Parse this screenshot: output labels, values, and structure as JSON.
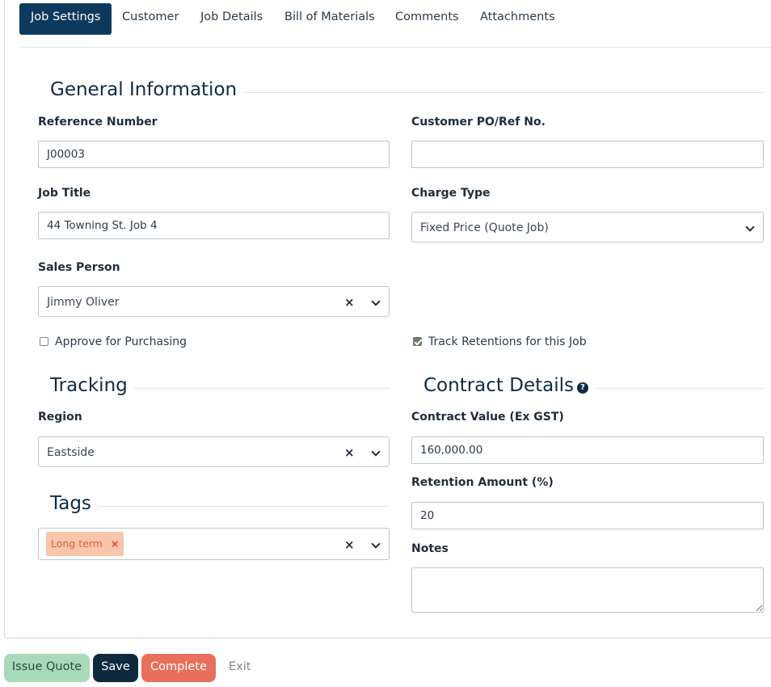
{
  "tabs": [
    {
      "label": "Job Settings",
      "active": true
    },
    {
      "label": "Customer"
    },
    {
      "label": "Job Details"
    },
    {
      "label": "Bill of Materials"
    },
    {
      "label": "Comments"
    },
    {
      "label": "Attachments"
    }
  ],
  "general": {
    "title": "General Information",
    "reference_label": "Reference Number",
    "reference_value": "J00003",
    "customer_po_label": "Customer PO/Ref No.",
    "customer_po_value": "",
    "job_title_label": "Job Title",
    "job_title_value": "44 Towning St. Job 4",
    "charge_type_label": "Charge Type",
    "charge_type_value": "Fixed Price (Quote Job)",
    "sales_person_label": "Sales Person",
    "sales_person_value": "Jimmy Oliver",
    "approve_label": "Approve for Purchasing",
    "approve_checked": false,
    "track_retentions_label": "Track Retentions for this Job",
    "track_retentions_checked": true
  },
  "tracking": {
    "title": "Tracking",
    "region_label": "Region",
    "region_value": "Eastside"
  },
  "tags": {
    "title": "Tags",
    "items": [
      "Long term"
    ]
  },
  "contract": {
    "title": "Contract Details",
    "contract_value_label": "Contract Value (Ex GST)",
    "contract_value": "160,000.00",
    "retention_label": "Retention Amount (%)",
    "retention_value": "20",
    "notes_label": "Notes",
    "notes_value": ""
  },
  "actions": {
    "issue_quote": "Issue Quote",
    "save": "Save",
    "complete": "Complete",
    "exit": "Exit"
  },
  "icons": {
    "clear": "×",
    "help": "?",
    "tag_remove": "×"
  },
  "colors": {
    "primary": "#0d3a5c",
    "issue_quote_bg": "#a8d9b8",
    "save_bg": "#0f2a3c",
    "complete_bg": "#e8705a",
    "tag_bg": "#f9c5ab"
  }
}
